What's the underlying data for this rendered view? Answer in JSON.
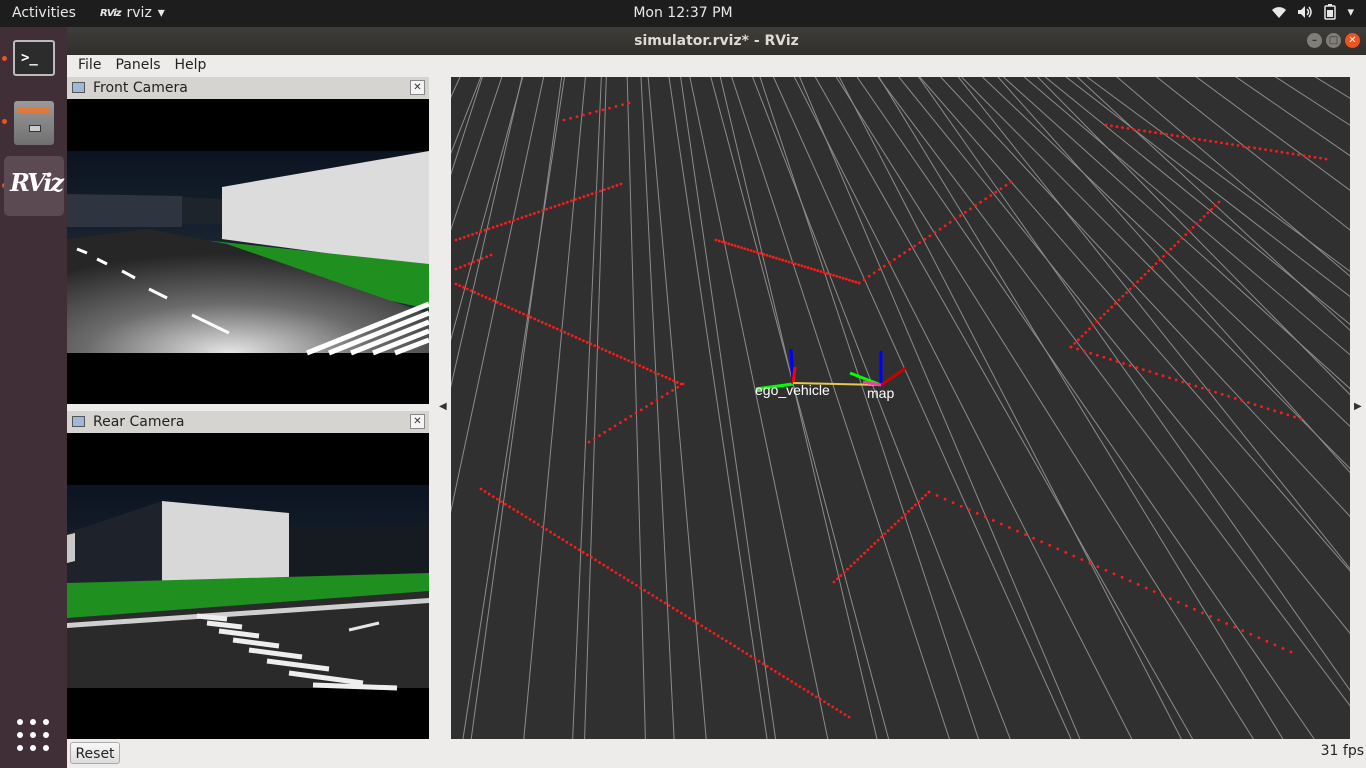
{
  "topbar": {
    "activities": "Activities",
    "app_icon_text": "RViz",
    "app_name": "rviz",
    "clock": "Mon 12:37 PM",
    "tray_icons": [
      "wifi-icon",
      "volume-icon",
      "battery-icon",
      "menu-caret-icon"
    ]
  },
  "dock": {
    "items": [
      {
        "name": "terminal",
        "icon": "terminal-icon",
        "glyph": ">_",
        "running": true
      },
      {
        "name": "files",
        "icon": "files-icon",
        "running": true
      },
      {
        "name": "rviz",
        "icon": "rviz-icon",
        "glyph": "RViz",
        "running": true,
        "active": true
      }
    ],
    "show_apps_icon": "app-grid-icon"
  },
  "window": {
    "title": "simulator.rviz* - RViz",
    "menu": [
      "File",
      "Panels",
      "Help"
    ]
  },
  "panels": {
    "front_camera": {
      "title": "Front Camera"
    },
    "rear_camera": {
      "title": "Rear Camera"
    }
  },
  "viewport": {
    "frames": [
      {
        "label": "ego_vehicle"
      },
      {
        "label": "map"
      }
    ],
    "colors": {
      "background": "#303030",
      "grid": "#8c8c8c",
      "points": "#ff1a1a",
      "x_axis": "#ff0000",
      "y_axis": "#00ff00",
      "z_axis": "#0000ff"
    }
  },
  "footer": {
    "reset_label": "Reset",
    "fps": "31 fps"
  }
}
